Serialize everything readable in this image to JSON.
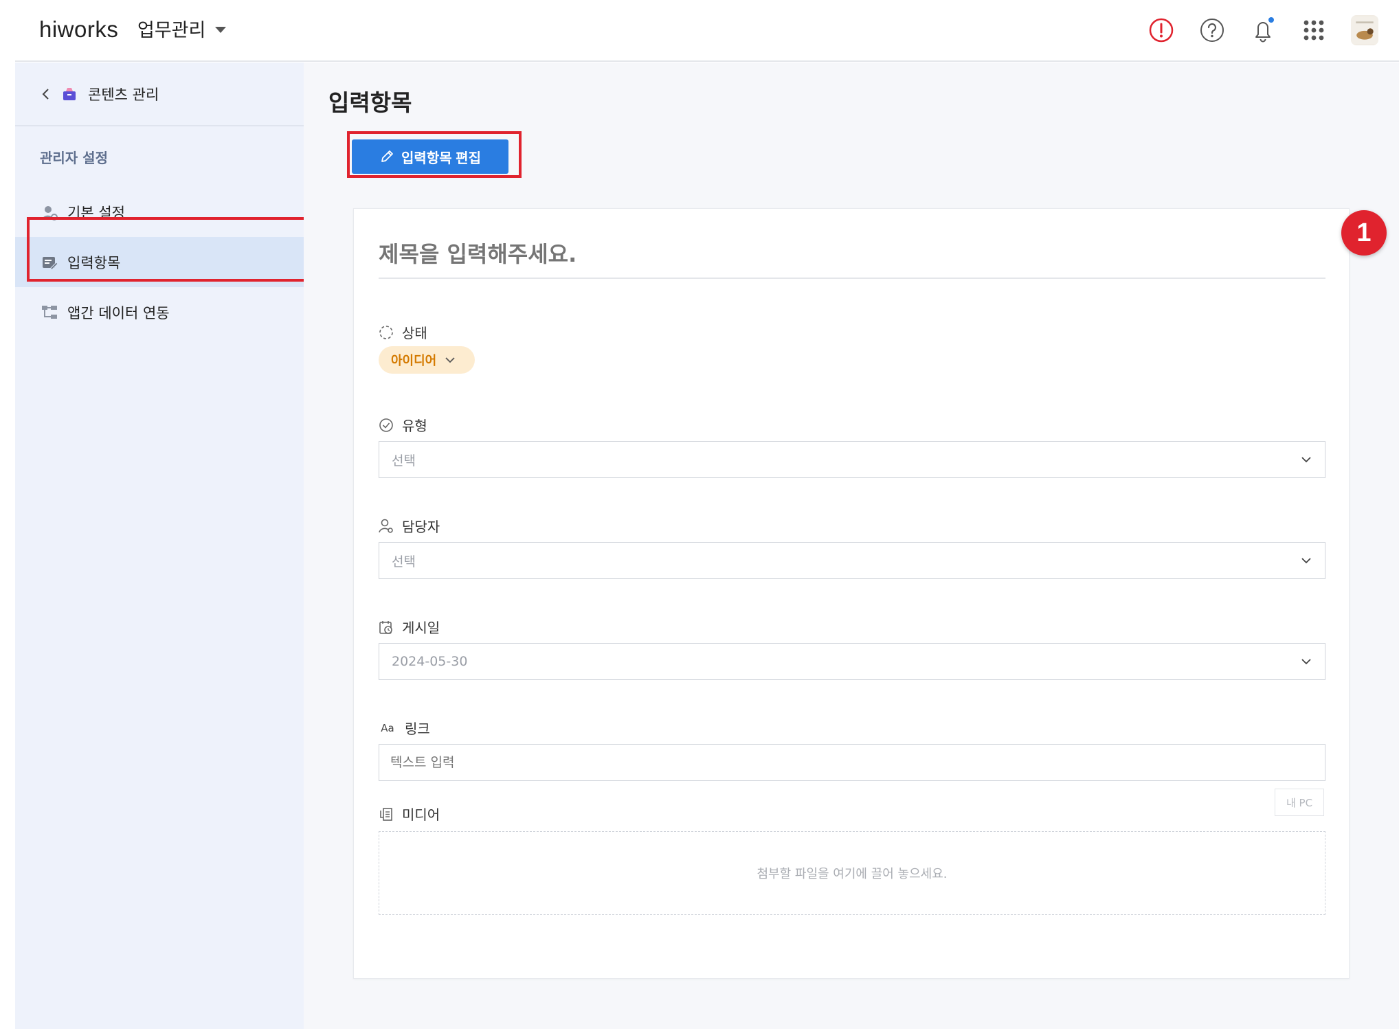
{
  "header": {
    "logo": "hiworks",
    "app_name": "업무관리",
    "icons": [
      "alert-icon",
      "help-icon",
      "bell-icon",
      "apps-grid-icon",
      "avatar"
    ],
    "colors": {
      "alert": "#e0232e",
      "notification_dot": "#2a7de1"
    }
  },
  "sidebar": {
    "back_label": "콘텐츠 관리",
    "section_title": "관리자 설정",
    "items": [
      {
        "label": "기본 설정",
        "icon": "user-gear-icon",
        "active": false
      },
      {
        "label": "입력항목",
        "icon": "form-edit-icon",
        "active": true
      },
      {
        "label": "앱간 데이터 연동",
        "icon": "data-link-icon",
        "active": false
      }
    ]
  },
  "main": {
    "page_title": "입력항목",
    "edit_button_label": "입력항목 편집",
    "form": {
      "title_placeholder": "제목을 입력해주세요.",
      "status": {
        "label": "상태",
        "value": "아이디어",
        "color": "#d47a00"
      },
      "type": {
        "label": "유형",
        "value": "선택"
      },
      "assignee": {
        "label": "담당자",
        "value": "선택"
      },
      "post_date": {
        "label": "게시일",
        "value": "2024-05-30"
      },
      "link": {
        "label": "링크",
        "icon_text": "Aa",
        "placeholder": "텍스트 입력"
      },
      "media": {
        "label": "미디어",
        "mypc_label": "내 PC",
        "dropzone_text": "첨부할 파일을 여기에 끌어 놓으세요."
      }
    }
  },
  "annotation": {
    "step_number": "1",
    "color": "#e0232e"
  },
  "colors": {
    "primary": "#2a7de1",
    "sidebar_bg": "#eef2fb",
    "sidebar_active": "#d9e5f7",
    "highlight": "#e0232e"
  }
}
